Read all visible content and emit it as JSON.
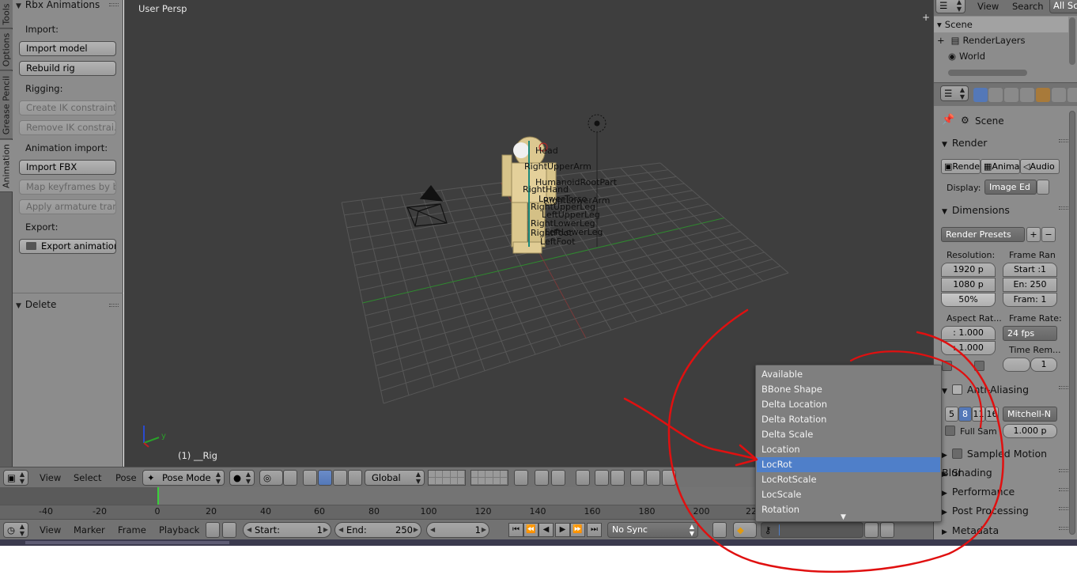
{
  "tool_tabs": [
    "Tools",
    "Options",
    "Grease Pencil",
    "Animation"
  ],
  "tool_shelf": {
    "panel_title": "Rbx Animations",
    "import_label": "Import:",
    "import_model": "Import model",
    "rebuild_rig": "Rebuild rig",
    "rigging_label": "Rigging:",
    "create_ik": "Create IK constraints",
    "remove_ik": "Remove IK constrai...",
    "anim_import_label": "Animation import:",
    "import_fbx": "Import FBX",
    "map_keyframes": "Map keyframes by b...",
    "apply_armature": "Apply armature tran...",
    "export_label": "Export:",
    "export_animation": "Export animation",
    "delete_panel": "Delete"
  },
  "viewport": {
    "view_name": "User Persp",
    "object_info": "(1) __Rig",
    "bone_labels": [
      "Head",
      "RightUpperArm",
      "HumanoidRootPart",
      "RightHand",
      "LowerTorso",
      "RightLowerArm",
      "RightUpperLeg",
      "LeftUpperLeg",
      "RightLowerLeg",
      "LeftLowerLeg",
      "RightFoot",
      "LeftFoot"
    ],
    "axis_y": "y"
  },
  "view3d_header": {
    "view": "View",
    "select": "Select",
    "pose": "Pose",
    "mode": "Pose Mode",
    "orientation": "Global"
  },
  "timeline": {
    "ticks": [
      "-40",
      "-20",
      "0",
      "20",
      "40",
      "60",
      "80",
      "100",
      "120",
      "140",
      "160",
      "180",
      "200",
      "22"
    ],
    "view": "View",
    "marker": "Marker",
    "frame": "Frame",
    "playback": "Playback",
    "start_label": "Start:",
    "start_value": "1",
    "end_label": "End:",
    "end_value": "250",
    "current_frame": "1",
    "sync": "No Sync"
  },
  "keying_set_menu": {
    "items": [
      "Available",
      "BBone Shape",
      "Delta Location",
      "Delta Rotation",
      "Delta Scale",
      "Location",
      "LocRot",
      "LocRotScale",
      "LocScale",
      "Rotation"
    ],
    "selected": "LocRot"
  },
  "outliner": {
    "menu_view": "View",
    "menu_search": "Search",
    "filter": "All Sc",
    "rows": [
      "Scene",
      "RenderLayers",
      "World"
    ]
  },
  "properties": {
    "context": "Scene",
    "render": {
      "title": "Render",
      "render_btn": "Rende",
      "anim_btn": "Anima",
      "audio_btn": "Audio",
      "display_label": "Display:",
      "display_value": "Image Ed"
    },
    "dimensions": {
      "title": "Dimensions",
      "presets": "Render Presets",
      "resolution_label": "Resolution:",
      "res_x": "1920 p",
      "res_y": "1080 p",
      "res_pct": "50%",
      "frame_range_label": "Frame Ran",
      "start": "Start :1",
      "end": "En: 250",
      "frame_step": "Fram: 1",
      "aspect_label": "Aspect Rat...",
      "aspect_x": ": 1.000",
      "aspect_y": ": 1.000",
      "frame_rate_label": "Frame Rate:",
      "fps": "24 fps",
      "time_remap_label": "Time Rem...",
      "time_remap_value": "1"
    },
    "anti_aliasing": {
      "title": "Anti-Aliasing",
      "samples": [
        "5",
        "8",
        "11",
        "16"
      ],
      "active_sample": "8",
      "filter": "Mitchell-N",
      "full_sample": "Full Sam",
      "filter_size": "1.000 p"
    },
    "sampled_motion_blur": "Sampled Motion Blur",
    "shading": "Shading",
    "performance": "Performance",
    "post_processing": "Post Processing",
    "metadata": "Metadata"
  },
  "colors": {
    "selection_blue": "#4f7fc9",
    "annotation_red": "#e01010",
    "timeline_cursor": "#3ad13a"
  }
}
